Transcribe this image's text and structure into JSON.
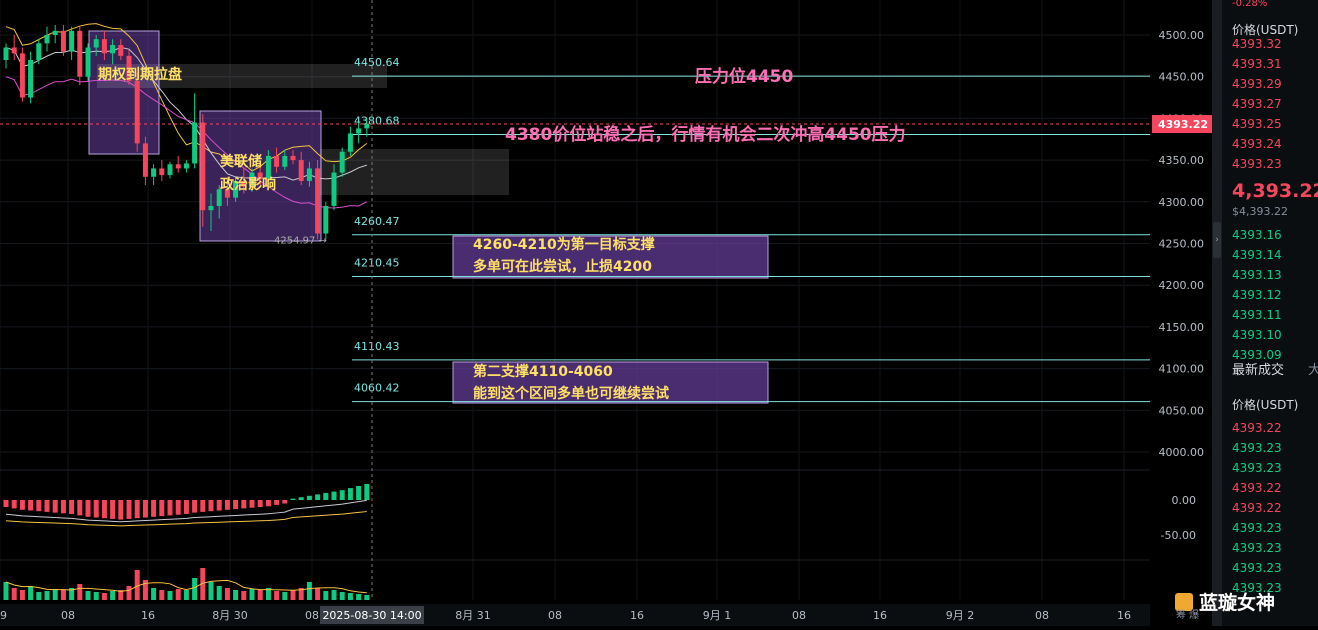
{
  "chart_data": {
    "type": "candlestick",
    "price_axis": {
      "ticks": [
        4500,
        4450,
        4400,
        4350,
        4300,
        4250,
        4200,
        4150,
        4100,
        4050,
        4000
      ],
      "labels": [
        "4500.00",
        "4450.00",
        "4400.00",
        "4350.00",
        "4300.00",
        "4250.00",
        "4200.00",
        "4150.00",
        "4100.00",
        "4050.00",
        "4000.00"
      ]
    },
    "macd_axis": {
      "labels": [
        "0.00",
        "-50.00"
      ]
    },
    "time_axis": {
      "labels": [
        "9",
        "08",
        "16",
        "8月 30",
        "08",
        "8月 31",
        "08",
        "16",
        "9月 1",
        "08",
        "16",
        "9月 2",
        "08",
        "16"
      ],
      "crosshair_label": "2025-08-30 14:00"
    },
    "current_price": 4393.22,
    "current_price_label": "4393.22",
    "price_levels": [
      {
        "value": 4450.64,
        "label": "4450.64"
      },
      {
        "value": 4380.68,
        "label": "4380.68"
      },
      {
        "value": 4260.47,
        "label": "4260.47"
      },
      {
        "value": 4210.45,
        "label": "4210.45"
      },
      {
        "value": 4110.43,
        "label": "4110.43"
      },
      {
        "value": 4060.42,
        "label": "4060.42"
      }
    ],
    "low_marker": {
      "value": 4254.97,
      "label": "4254.97"
    },
    "candles": [
      {
        "o": 4470,
        "h": 4490,
        "l": 4460,
        "c": 4485
      },
      {
        "o": 4485,
        "h": 4500,
        "l": 4470,
        "c": 4478
      },
      {
        "o": 4478,
        "h": 4485,
        "l": 4420,
        "c": 4425
      },
      {
        "o": 4425,
        "h": 4480,
        "l": 4418,
        "c": 4470
      },
      {
        "o": 4470,
        "h": 4495,
        "l": 4465,
        "c": 4490
      },
      {
        "o": 4490,
        "h": 4510,
        "l": 4480,
        "c": 4500
      },
      {
        "o": 4500,
        "h": 4512,
        "l": 4490,
        "c": 4505
      },
      {
        "o": 4505,
        "h": 4512,
        "l": 4475,
        "c": 4480
      },
      {
        "o": 4480,
        "h": 4510,
        "l": 4470,
        "c": 4505
      },
      {
        "o": 4505,
        "h": 4510,
        "l": 4440,
        "c": 4450
      },
      {
        "o": 4450,
        "h": 4490,
        "l": 4445,
        "c": 4485
      },
      {
        "o": 4485,
        "h": 4500,
        "l": 4475,
        "c": 4495
      },
      {
        "o": 4495,
        "h": 4505,
        "l": 4470,
        "c": 4478
      },
      {
        "o": 4478,
        "h": 4495,
        "l": 4465,
        "c": 4488
      },
      {
        "o": 4488,
        "h": 4495,
        "l": 4470,
        "c": 4475
      },
      {
        "o": 4475,
        "h": 4482,
        "l": 4440,
        "c": 4445
      },
      {
        "o": 4445,
        "h": 4455,
        "l": 4360,
        "c": 4370
      },
      {
        "o": 4370,
        "h": 4378,
        "l": 4320,
        "c": 4330
      },
      {
        "o": 4330,
        "h": 4345,
        "l": 4320,
        "c": 4340
      },
      {
        "o": 4340,
        "h": 4350,
        "l": 4325,
        "c": 4332
      },
      {
        "o": 4332,
        "h": 4348,
        "l": 4328,
        "c": 4345
      },
      {
        "o": 4345,
        "h": 4355,
        "l": 4335,
        "c": 4340
      },
      {
        "o": 4340,
        "h": 4350,
        "l": 4335,
        "c": 4346
      },
      {
        "o": 4346,
        "h": 4430,
        "l": 4340,
        "c": 4395
      },
      {
        "o": 4395,
        "h": 4405,
        "l": 4270,
        "c": 4290
      },
      {
        "o": 4290,
        "h": 4310,
        "l": 4265,
        "c": 4295
      },
      {
        "o": 4295,
        "h": 4320,
        "l": 4280,
        "c": 4315
      },
      {
        "o": 4315,
        "h": 4330,
        "l": 4295,
        "c": 4305
      },
      {
        "o": 4305,
        "h": 4330,
        "l": 4300,
        "c": 4325
      },
      {
        "o": 4325,
        "h": 4340,
        "l": 4310,
        "c": 4318
      },
      {
        "o": 4318,
        "h": 4340,
        "l": 4312,
        "c": 4335
      },
      {
        "o": 4335,
        "h": 4345,
        "l": 4320,
        "c": 4328
      },
      {
        "o": 4328,
        "h": 4362,
        "l": 4322,
        "c": 4355
      },
      {
        "o": 4355,
        "h": 4365,
        "l": 4335,
        "c": 4342
      },
      {
        "o": 4342,
        "h": 4362,
        "l": 4338,
        "c": 4355
      },
      {
        "o": 4355,
        "h": 4362,
        "l": 4345,
        "c": 4350
      },
      {
        "o": 4350,
        "h": 4360,
        "l": 4320,
        "c": 4325
      },
      {
        "o": 4325,
        "h": 4348,
        "l": 4318,
        "c": 4340
      },
      {
        "o": 4340,
        "h": 4350,
        "l": 4255,
        "c": 4262
      },
      {
        "o": 4262,
        "h": 4300,
        "l": 4255,
        "c": 4295
      },
      {
        "o": 4295,
        "h": 4345,
        "l": 4290,
        "c": 4335
      },
      {
        "o": 4335,
        "h": 4365,
        "l": 4330,
        "c": 4360
      },
      {
        "o": 4360,
        "h": 4390,
        "l": 4355,
        "c": 4382
      },
      {
        "o": 4382,
        "h": 4395,
        "l": 4370,
        "c": 4388
      },
      {
        "o": 4388,
        "h": 4400,
        "l": 4378,
        "c": 4393.22
      }
    ],
    "macd": [
      -10,
      -12,
      -14,
      -15,
      -16,
      -17,
      -18,
      -19,
      -20,
      -22,
      -24,
      -25,
      -26,
      -27,
      -28,
      -27,
      -26,
      -25,
      -24,
      -23,
      -22,
      -21,
      -20,
      -18,
      -17,
      -16,
      -15,
      -14,
      -13,
      -12,
      -11,
      -10,
      -9,
      -7,
      -5,
      2,
      4,
      6,
      8,
      10,
      12,
      14,
      17,
      20,
      23
    ],
    "volume": [
      18,
      12,
      10,
      14,
      8,
      9,
      11,
      10,
      12,
      16,
      9,
      8,
      7,
      9,
      10,
      14,
      30,
      20,
      12,
      10,
      9,
      11,
      10,
      22,
      32,
      18,
      14,
      12,
      10,
      9,
      11,
      10,
      12,
      9,
      8,
      10,
      12,
      18,
      12,
      9,
      10,
      8,
      7,
      6,
      5
    ]
  },
  "annotations": {
    "option_expiry": "期权到期拉盘",
    "fed_politics_line1": "美联储",
    "fed_politics_line2": "政治影响",
    "resistance": "压力位4450",
    "breakout_note": "4380价位站稳之后，行情有机会二次冲高4450压力",
    "support1_line1": "4260-4210为第一目标支撑",
    "support1_line2": "多单可在此尝试，止损4200",
    "support2_line1": "第二支撑4110-4060",
    "support2_line2": "能到这个区间多单也可继续尝试"
  },
  "orderbook": {
    "top_partial": "-0.28%",
    "header": "价格(USDT)",
    "asks": [
      "4393.32",
      "4393.31",
      "4393.29",
      "4393.27",
      "4393.25",
      "4393.24",
      "4393.23"
    ],
    "last_price": "4,393.22",
    "last_price_sub": "$4,393.22",
    "bids": [
      "4393.16",
      "4393.14",
      "4393.13",
      "4393.12",
      "4393.11",
      "4393.10",
      "4393.09"
    ],
    "trades_tab": "最新成交",
    "trades_tab2": "大",
    "trades_header": "价格(USDT)",
    "trades": [
      {
        "p": "4393.22",
        "side": "red"
      },
      {
        "p": "4393.23",
        "side": "green"
      },
      {
        "p": "4393.23",
        "side": "green"
      },
      {
        "p": "4393.22",
        "side": "red"
      },
      {
        "p": "4393.22",
        "side": "red"
      },
      {
        "p": "4393.23",
        "side": "green"
      },
      {
        "p": "4393.23",
        "side": "green"
      },
      {
        "p": "4393.23",
        "side": "green"
      },
      {
        "p": "4393.23",
        "side": "green"
      }
    ]
  },
  "watermark": "蓝璇女神",
  "footer_left": "筹 爆",
  "colors": {
    "up": "#0ecb81",
    "down": "#f6465d",
    "level_line": "#7fe3e0",
    "annot_yellow": "#ffe066",
    "annot_pink": "#ff6fb5",
    "box_purple": "#6a3fa0"
  }
}
